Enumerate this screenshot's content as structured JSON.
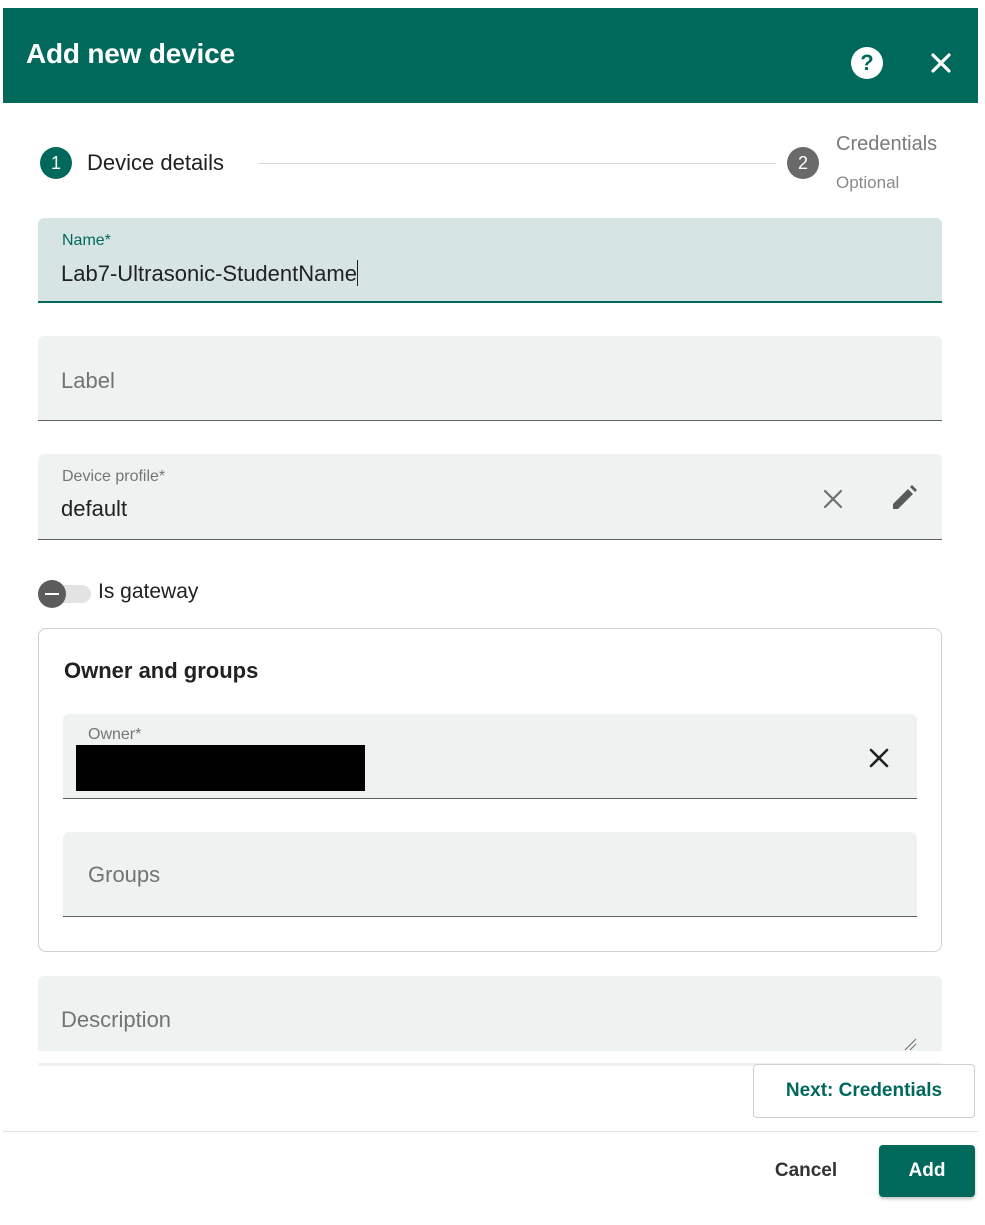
{
  "dialog": {
    "title": "Add new device",
    "help_icon": "help-circle-icon",
    "help_glyph": "?",
    "close_icon": "close-icon"
  },
  "stepper": {
    "steps": [
      {
        "number": "1",
        "label": "Device details",
        "active": true
      },
      {
        "number": "2",
        "label": "Credentials",
        "sublabel": "Optional",
        "active": false
      }
    ]
  },
  "form": {
    "name": {
      "label": "Name*",
      "value": "Lab7-Ultrasonic-StudentName",
      "focused": true
    },
    "label": {
      "placeholder": "Label",
      "value": ""
    },
    "device_profile": {
      "label": "Device profile*",
      "value": "default",
      "clear_icon": "close-icon",
      "edit_icon": "pencil-icon"
    },
    "is_gateway": {
      "label": "Is gateway",
      "checked": false
    },
    "owner_groups": {
      "title": "Owner and groups",
      "owner": {
        "label": "Owner*",
        "value_redacted": true,
        "clear_icon": "close-icon"
      },
      "groups": {
        "placeholder": "Groups"
      }
    },
    "description": {
      "placeholder": "Description"
    }
  },
  "actions": {
    "next": "Next: Credentials",
    "cancel": "Cancel",
    "add": "Add"
  },
  "colors": {
    "primary": "#00695c",
    "field_bg": "#eef3f2",
    "field_focused_bg": "#d6e5e3",
    "step_inactive": "#6a6a6a"
  }
}
